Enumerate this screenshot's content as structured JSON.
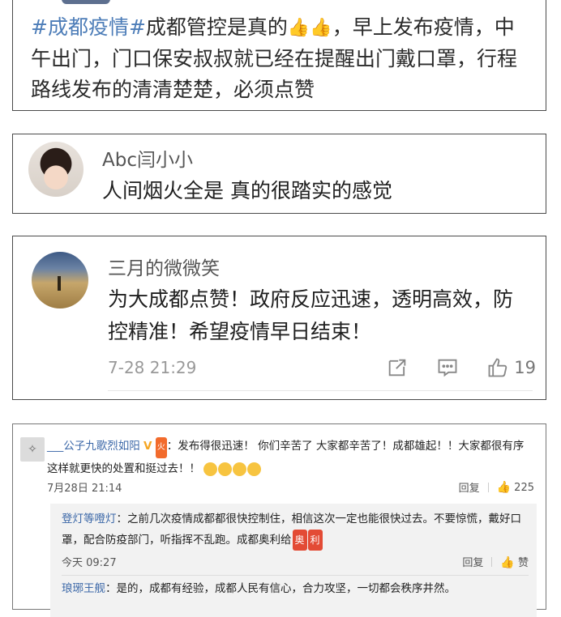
{
  "post": {
    "hashtag": "#成都疫情#",
    "text_after_hashtag": "成都管控是真的",
    "thumb_emoji": "👍",
    "text_rest": "，早上发布疫情，中午出门，门口保安叔叔就已经在提醒出门戴口罩，行程路线发布的清清楚楚，必须点赞"
  },
  "comment1": {
    "username": "Abc闫小小",
    "text": "人间烟火全是 真的很踏实的感觉"
  },
  "comment2": {
    "username": "三月的微微笑",
    "text": "为大成都点赞！政府反应迅速，透明高效，防控精准！希望疫情早日结束！",
    "time": "7-28 21:29",
    "likes": "19"
  },
  "thread": {
    "username": "___公子九歌烈如阳",
    "vbadge": "V",
    "badge_text": "火",
    "text": "：发布得很迅速！ 你们辛苦了 大家都辛苦了！成都雄起！！大家都很有序 这样就更快的处置和挺过去！！",
    "time": "7月28日 21:14",
    "reply_label": "回复",
    "likes": "225",
    "replies": [
      {
        "username": "登灯等噔灯",
        "text": "：之前几次疫情成都都很快控制住，相信这次一定也能很快过去。不要惊慌，戴好口罩，配合防疫部门，听指挥不乱跑。成都奥利给",
        "tags": [
          "奥",
          "利"
        ],
        "time": "今天 09:27",
        "reply_label": "回复",
        "like_label": "赞"
      },
      {
        "username": "琅琊王舰",
        "text": "：是的，成都有经验，成都人民有信心，合力攻坚，一切都会秩序井然。"
      }
    ]
  },
  "colors": {
    "link": "#3c68a8",
    "hashtag": "#4d7db8",
    "muted": "#999999",
    "border": "#4a4a4a"
  }
}
